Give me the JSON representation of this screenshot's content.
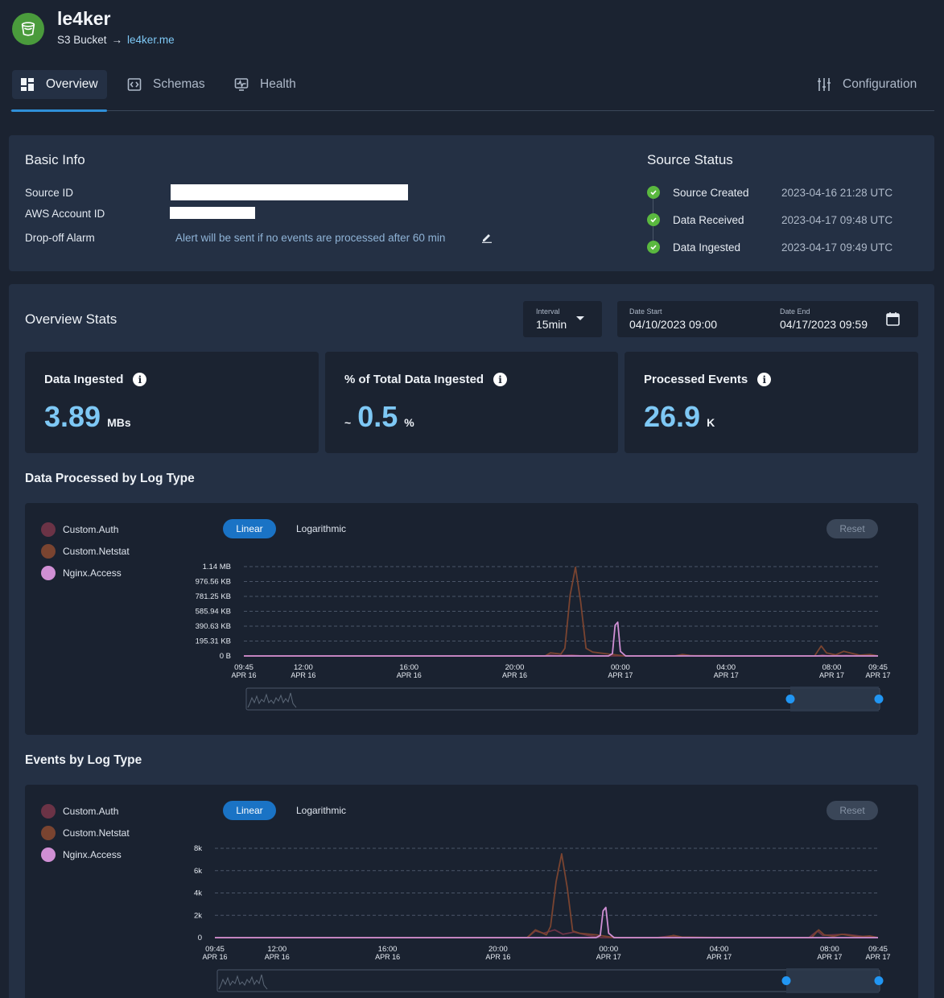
{
  "header": {
    "title": "le4ker",
    "subtitle_type": "S3 Bucket",
    "subtitle_arrow": "→",
    "subtitle_link": "le4ker.me"
  },
  "tabs": [
    {
      "label": "Overview",
      "icon": "dashboard-icon",
      "active": true
    },
    {
      "label": "Schemas",
      "icon": "code-brackets-icon",
      "active": false
    },
    {
      "label": "Health",
      "icon": "health-monitor-icon",
      "active": false
    }
  ],
  "configuration_label": "Configuration",
  "basic_info": {
    "title": "Basic Info",
    "source_id_label": "Source ID",
    "aws_account_label": "AWS Account ID",
    "dropoff_label": "Drop-off Alarm",
    "dropoff_value": "Alert will be sent if no events are processed after 60 min"
  },
  "source_status": {
    "title": "Source Status",
    "items": [
      {
        "label": "Source Created",
        "time": "2023-04-16 21:28 UTC"
      },
      {
        "label": "Data Received",
        "time": "2023-04-17 09:48 UTC"
      },
      {
        "label": "Data Ingested",
        "time": "2023-04-17 09:49 UTC"
      }
    ]
  },
  "overview_stats": {
    "title": "Overview Stats",
    "interval_label": "Interval",
    "interval_value": "15min",
    "date_start_label": "Date Start",
    "date_start_value": "04/10/2023 09:00",
    "date_end_label": "Date End",
    "date_end_value": "04/17/2023 09:59",
    "cards": [
      {
        "title": "Data Ingested",
        "prefix": "",
        "value": "3.89",
        "unit": "MBs"
      },
      {
        "title": "% of Total Data Ingested",
        "prefix": "~",
        "value": "0.5",
        "unit": "%"
      },
      {
        "title": "Processed Events",
        "prefix": "",
        "value": "26.9",
        "unit": "K"
      }
    ]
  },
  "legend": [
    {
      "name": "Custom.Auth",
      "color": "#6b3346"
    },
    {
      "name": "Custom.Netstat",
      "color": "#7a4430"
    },
    {
      "name": "Nginx.Access",
      "color": "#d08fd4"
    }
  ],
  "controls": {
    "linear": "Linear",
    "logarithmic": "Logarithmic",
    "reset": "Reset"
  },
  "chart_data": [
    {
      "type": "line",
      "title": "Data Processed by Log Type",
      "y_ticks": [
        "0 B",
        "195.31 KB",
        "390.63 KB",
        "585.94 KB",
        "781.25 KB",
        "976.56 KB",
        "1.14 MB"
      ],
      "x_ticks": [
        {
          "time": "09:45",
          "date": "APR 16"
        },
        {
          "time": "12:00",
          "date": "APR 16"
        },
        {
          "time": "16:00",
          "date": "APR 16"
        },
        {
          "time": "20:00",
          "date": "APR 16"
        },
        {
          "time": "00:00",
          "date": "APR 17"
        },
        {
          "time": "04:00",
          "date": "APR 17"
        },
        {
          "time": "08:00",
          "date": "APR 17"
        },
        {
          "time": "09:45",
          "date": "APR 17"
        }
      ],
      "x_hours": [
        0,
        2.25,
        6.25,
        10.25,
        14.25,
        18.25,
        22.25,
        24
      ],
      "ylim_kb": [
        0,
        1167
      ],
      "series": [
        {
          "name": "Custom.Auth",
          "points": [
            [
              0,
              0
            ],
            [
              11.4,
              0
            ],
            [
              11.6,
              10
            ],
            [
              11.9,
              3
            ],
            [
              12.4,
              12
            ],
            [
              12.7,
              4
            ],
            [
              13.4,
              2
            ],
            [
              14,
              0
            ],
            [
              16.5,
              0
            ],
            [
              16.8,
              8
            ],
            [
              17.1,
              0
            ],
            [
              21.7,
              0
            ],
            [
              21.9,
              12
            ],
            [
              22.1,
              2
            ],
            [
              22.8,
              8
            ],
            [
              23.2,
              2
            ],
            [
              24,
              0
            ]
          ]
        },
        {
          "name": "Custom.Netstat",
          "points": [
            [
              0,
              0
            ],
            [
              11.4,
              0
            ],
            [
              11.6,
              40
            ],
            [
              12,
              25
            ],
            [
              12.15,
              100
            ],
            [
              12.35,
              800
            ],
            [
              12.55,
              1160
            ],
            [
              12.75,
              700
            ],
            [
              12.95,
              100
            ],
            [
              13.2,
              50
            ],
            [
              13.8,
              25
            ],
            [
              14.3,
              5
            ],
            [
              14.6,
              0
            ],
            [
              16.3,
              0
            ],
            [
              16.6,
              20
            ],
            [
              16.9,
              5
            ],
            [
              18.5,
              0
            ],
            [
              21.6,
              0
            ],
            [
              21.85,
              130
            ],
            [
              22.05,
              40
            ],
            [
              22.4,
              15
            ],
            [
              22.7,
              60
            ],
            [
              22.95,
              40
            ],
            [
              23.3,
              10
            ],
            [
              23.7,
              20
            ],
            [
              24,
              0
            ]
          ]
        },
        {
          "name": "Nginx.Access",
          "points": [
            [
              0,
              0
            ],
            [
              13.8,
              0
            ],
            [
              13.95,
              30
            ],
            [
              14.05,
              400
            ],
            [
              14.15,
              440
            ],
            [
              14.25,
              60
            ],
            [
              14.45,
              0
            ],
            [
              24,
              0
            ]
          ]
        }
      ]
    },
    {
      "type": "line",
      "title": "Events by Log Type",
      "y_ticks": [
        "0",
        "2k",
        "4k",
        "6k",
        "8k"
      ],
      "x_ticks": [
        {
          "time": "09:45",
          "date": "APR 16"
        },
        {
          "time": "12:00",
          "date": "APR 16"
        },
        {
          "time": "16:00",
          "date": "APR 16"
        },
        {
          "time": "20:00",
          "date": "APR 16"
        },
        {
          "time": "00:00",
          "date": "APR 17"
        },
        {
          "time": "04:00",
          "date": "APR 17"
        },
        {
          "time": "08:00",
          "date": "APR 17"
        },
        {
          "time": "09:45",
          "date": "APR 17"
        }
      ],
      "x_hours": [
        0,
        2.25,
        6.25,
        10.25,
        14.25,
        18.25,
        22.25,
        24
      ],
      "ylim": [
        0,
        8000
      ],
      "series": [
        {
          "name": "Custom.Auth",
          "points": [
            [
              0,
              0
            ],
            [
              11.3,
              0
            ],
            [
              11.6,
              600
            ],
            [
              11.9,
              400
            ],
            [
              12.3,
              700
            ],
            [
              12.6,
              300
            ],
            [
              13,
              500
            ],
            [
              13.5,
              200
            ],
            [
              14,
              0
            ],
            [
              16,
              0
            ],
            [
              16.5,
              150
            ],
            [
              17,
              0
            ],
            [
              21.5,
              0
            ],
            [
              21.8,
              600
            ],
            [
              22,
              200
            ],
            [
              22.8,
              300
            ],
            [
              23.5,
              100
            ],
            [
              24,
              0
            ]
          ]
        },
        {
          "name": "Custom.Netstat",
          "points": [
            [
              0,
              0
            ],
            [
              11.3,
              0
            ],
            [
              11.6,
              700
            ],
            [
              12,
              250
            ],
            [
              12.15,
              1000
            ],
            [
              12.35,
              5000
            ],
            [
              12.55,
              7500
            ],
            [
              12.75,
              4500
            ],
            [
              12.95,
              600
            ],
            [
              13.2,
              400
            ],
            [
              13.8,
              250
            ],
            [
              14.3,
              60
            ],
            [
              14.6,
              0
            ],
            [
              16.3,
              0
            ],
            [
              16.6,
              200
            ],
            [
              16.9,
              50
            ],
            [
              18.5,
              0
            ],
            [
              21.6,
              0
            ],
            [
              21.85,
              700
            ],
            [
              22.05,
              250
            ],
            [
              22.4,
              120
            ],
            [
              22.7,
              300
            ],
            [
              22.95,
              200
            ],
            [
              23.3,
              80
            ],
            [
              23.7,
              150
            ],
            [
              24,
              0
            ]
          ]
        },
        {
          "name": "Nginx.Access",
          "points": [
            [
              0,
              0
            ],
            [
              13.8,
              0
            ],
            [
              13.95,
              200
            ],
            [
              14.05,
              2400
            ],
            [
              14.15,
              2700
            ],
            [
              14.25,
              400
            ],
            [
              14.45,
              0
            ],
            [
              24,
              0
            ]
          ]
        }
      ]
    }
  ]
}
